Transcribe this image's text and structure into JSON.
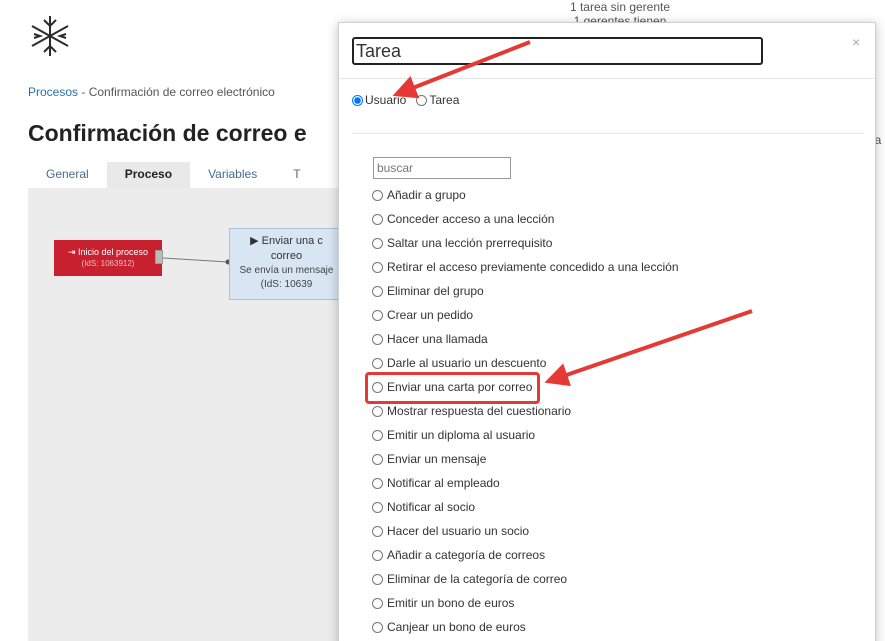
{
  "background": {
    "top_status": [
      "1 tarea sin gerente",
      "1 gerentes tienen"
    ],
    "breadcrumb": {
      "root": "Procesos",
      "separator": "-",
      "current": "Confirmación de correo electrónico"
    },
    "page_title": "Confirmación de correo e",
    "tabs": [
      "General",
      "Proceso",
      "Variables",
      "T"
    ],
    "active_tab": "Proceso",
    "side_text": "la",
    "start_node": {
      "label": "Inicio del proceso",
      "id_text": "(IdS: 1063912)"
    },
    "task_node": {
      "title": "Enviar una c",
      "title2": "correo",
      "desc": "Se envía un mensaje",
      "id_text": "(IdS: 10639"
    },
    "colors": {
      "start_node": "#c8202e",
      "task_node": "#d8e5f2",
      "link": "#2a6fb0",
      "annotation": "#e53935"
    }
  },
  "modal": {
    "title_value": "Tarea",
    "close_label": "×",
    "type_options": [
      {
        "label": "Usuario",
        "checked": true
      },
      {
        "label": "Tarea",
        "checked": false
      }
    ],
    "search_placeholder": "buscar",
    "actions": [
      "Añadir a grupo",
      "Conceder acceso a una lección",
      "Saltar una lección prerrequisito",
      "Retirar el acceso previamente concedido a una lección",
      "Eliminar del grupo",
      "Crear un pedido",
      "Hacer una llamada",
      "Darle al usuario un descuento",
      "Enviar una carta por correo",
      "Mostrar respuesta del cuestionario",
      "Emitir un diploma al usuario",
      "Enviar un mensaje",
      "Notificar al empleado",
      "Notificar al socio",
      "Hacer del usuario un socio",
      "Añadir a categoría de correos",
      "Eliminar de la categoría de correo",
      "Emitir un bono de euros",
      "Canjear un bono de euros"
    ],
    "highlighted_action": "Enviar una carta por correo"
  }
}
